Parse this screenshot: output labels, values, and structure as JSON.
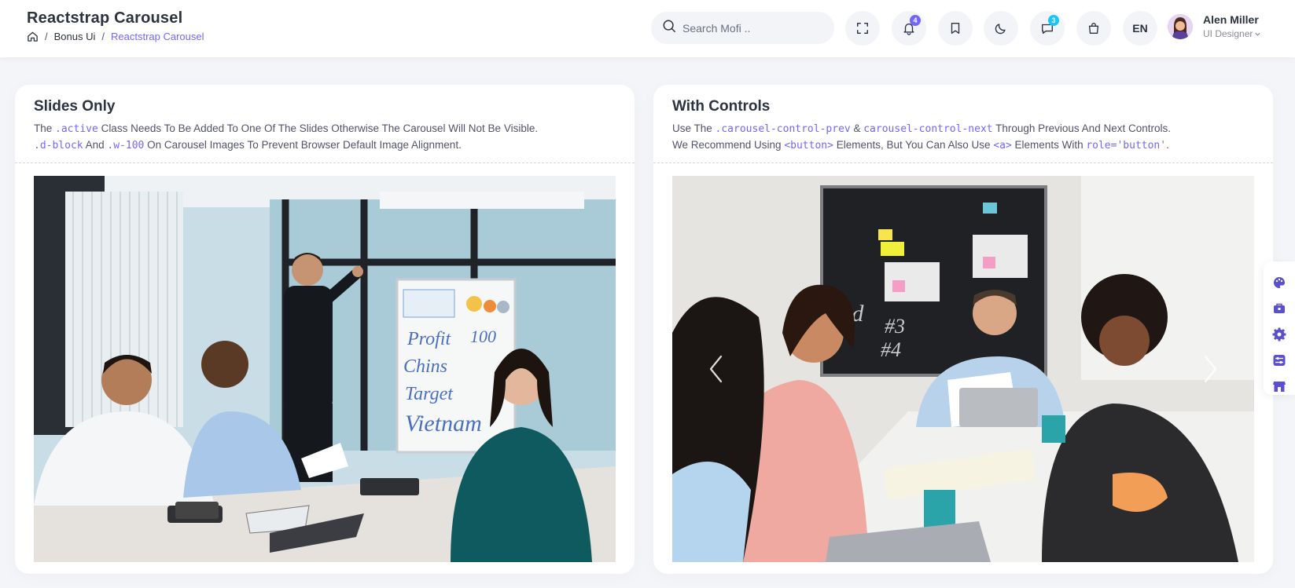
{
  "header": {
    "page_title": "Reactstrap Carousel",
    "breadcrumb": {
      "items": [
        "Bonus Ui",
        "Reactstrap Carousel"
      ]
    },
    "search": {
      "placeholder": "Search Mofi .."
    },
    "notifications_count": "4",
    "messages_count": "3",
    "language": "EN",
    "user": {
      "name": "Alen Miller",
      "role": "UI Designer"
    }
  },
  "cards": {
    "slides_only": {
      "title": "Slides Only",
      "desc1_pre": "The ",
      "desc1_code": ".active",
      "desc1_post": " Class Needs To Be Added To One Of The Slides Otherwise The Carousel Will Not Be Visible.",
      "desc2_code1": ".d-block",
      "desc2_mid": " And ",
      "desc2_code2": ".w-100",
      "desc2_post": " On Carousel Images To Prevent Browser Default Image Alignment."
    },
    "with_controls": {
      "title": "With Controls",
      "desc1_pre": "Use The ",
      "desc1_code1": ".carousel-control-prev",
      "desc1_mid": " & ",
      "desc1_code2": "carousel-control-next",
      "desc1_post": " Through Previous And Next Controls.",
      "desc2_pre": "We Recommend Using ",
      "desc2_code1": "<button>",
      "desc2_mid": " Elements, But You Can Also Use ",
      "desc2_code2": "<a>",
      "desc2_mid2": " Elements With ",
      "desc2_code3": "role='button'",
      "desc2_post": "."
    }
  },
  "slide1_board": {
    "lines": [
      "Profit",
      "100",
      "Chins",
      "Target",
      "Vietnam"
    ]
  },
  "slide2_board": {
    "lines": [
      "ed",
      "#3",
      "#4"
    ]
  },
  "colors": {
    "accent": "#7366ff",
    "cyan_badge": "#16c7f9",
    "page_bg": "#f4f5f8"
  },
  "side_tools": [
    "palette-icon",
    "briefcase-icon",
    "gear-icon",
    "sliders-icon",
    "store-icon"
  ]
}
